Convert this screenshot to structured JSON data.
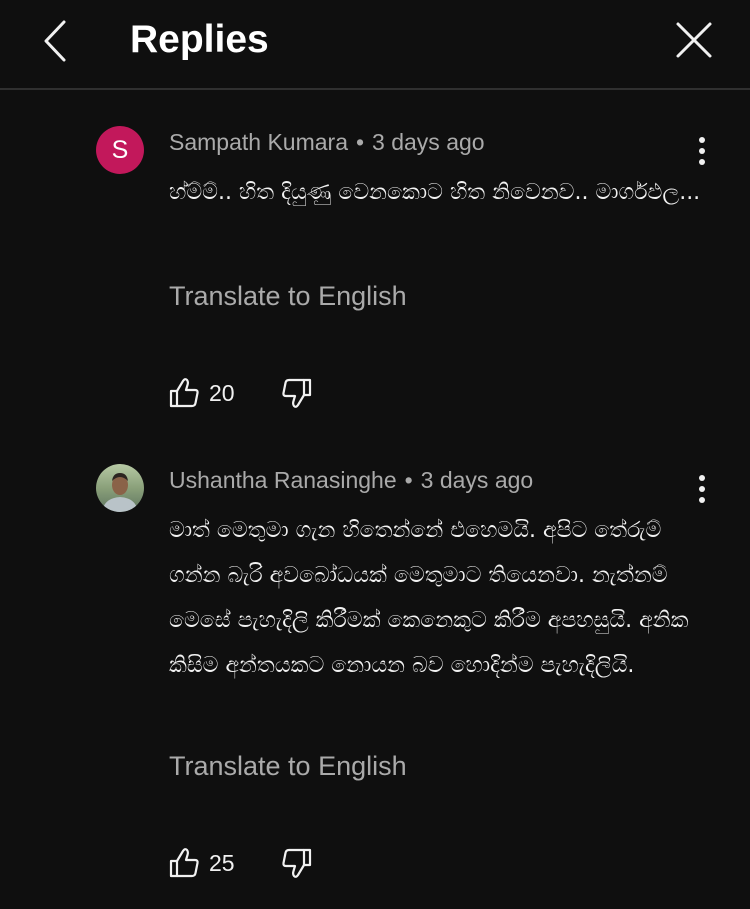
{
  "header": {
    "title": "Replies",
    "back_icon": "chevron-left-icon",
    "close_icon": "close-icon"
  },
  "replies": [
    {
      "author": "Sampath Kumara",
      "separator": "•",
      "time": "3 days ago",
      "avatar": {
        "type": "letter",
        "letter": "S",
        "color": "#c2185b"
      },
      "text": "හ්ම්ම්.. හිත දියුණු වෙනකොට හිත නිවෙනව.. මාර්ගඵල...",
      "translate_label": "Translate to English",
      "likes": "20"
    },
    {
      "author": "Ushantha Ranasinghe",
      "separator": "•",
      "time": "3 days ago",
      "avatar": {
        "type": "photo"
      },
      "text": "මාත් මෙතුමා ගැන හිතෙන්නේ එහෙමයි. අපිට තේරුම් ගන්න බැරි අවබෝධයක් මෙතුමාට තියෙනවා. නැත්නම් මෙසේ පැහැදිලි කිරීමක් කෙනෙකුට කිරීම අපහසුයි. අනික කිසිම අන්තයකට නොයන බව හොදින්ම පැහැදිලියි.",
      "translate_label": "Translate to English",
      "likes": "25"
    }
  ],
  "colors": {
    "background": "#0f0f0f",
    "text_primary": "#f1f1f1",
    "text_secondary": "#aaaaaa",
    "divider": "#303030"
  }
}
